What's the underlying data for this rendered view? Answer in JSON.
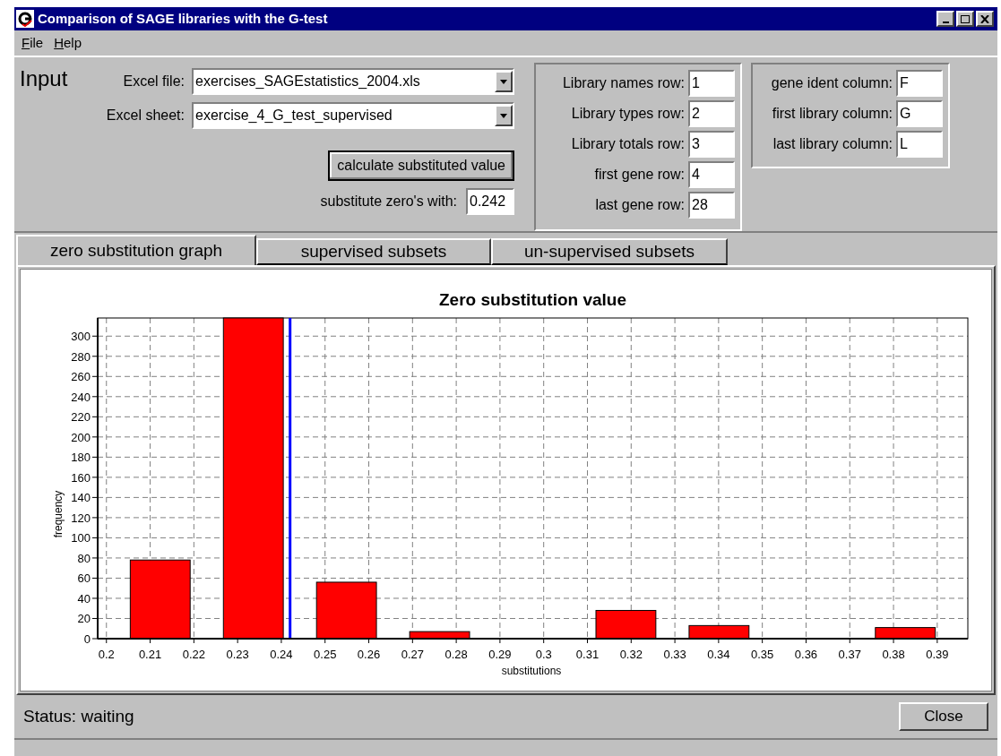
{
  "window": {
    "title": "Comparison of SAGE libraries with the G-test"
  },
  "menu": [
    {
      "label": "File"
    },
    {
      "label": "Help"
    }
  ],
  "input": {
    "heading": "Input",
    "excel_file": {
      "label": "Excel file:",
      "value": "exercises_SAGEstatistics_2004.xls"
    },
    "excel_sheet": {
      "label": "Excel sheet:",
      "value": "exercise_4_G_test_supervised"
    },
    "calculate_button": "calculate substituted value",
    "substitute": {
      "label": "substitute zero's with:",
      "value": "0.242"
    },
    "rows": [
      {
        "label": "Library names row:",
        "value": "1"
      },
      {
        "label": "Library types row:",
        "value": "2"
      },
      {
        "label": "Library totals row:",
        "value": "3"
      },
      {
        "label": "first gene row:",
        "value": "4"
      },
      {
        "label": "last gene row:",
        "value": "28"
      }
    ],
    "columns": [
      {
        "label": "gene ident column:",
        "value": "F"
      },
      {
        "label": "first library column:",
        "value": "G"
      },
      {
        "label": "last library column:",
        "value": "L"
      }
    ]
  },
  "tabs": [
    {
      "label": "zero substitution graph",
      "selected": true
    },
    {
      "label": "supervised subsets",
      "selected": false
    },
    {
      "label": "un-supervised subsets",
      "selected": false
    }
  ],
  "chart": {
    "chart_data": {
      "type": "bar",
      "title": "Zero substitution value",
      "xlabel": "substitutions",
      "ylabel": "frequency",
      "x": [
        0.2123,
        0.2336,
        0.2549,
        0.2762,
        0.2975,
        0.3188,
        0.3401,
        0.3614,
        0.3827
      ],
      "series": [
        {
          "color": "#ff0000",
          "values": [
            78,
            318,
            56,
            7,
            0,
            28,
            13,
            0,
            11
          ]
        }
      ],
      "grid": true,
      "xlim": [
        0.198,
        0.397
      ],
      "ylim": [
        0,
        318
      ],
      "xticks": [
        0.2,
        0.21,
        0.22,
        0.23,
        0.24,
        0.25,
        0.26,
        0.27,
        0.28,
        0.29,
        0.3,
        0.31,
        0.32,
        0.33,
        0.34,
        0.35,
        0.36,
        0.37,
        0.38,
        0.39
      ],
      "yticks": [
        0,
        20,
        40,
        60,
        80,
        100,
        120,
        140,
        160,
        180,
        200,
        220,
        240,
        260,
        280,
        300
      ],
      "ref_lines": [
        {
          "axis": "x",
          "value": 0.242,
          "color": "#0000ff"
        }
      ]
    }
  },
  "status": {
    "label": "Status:",
    "value": "waiting"
  },
  "close_button": "Close"
}
